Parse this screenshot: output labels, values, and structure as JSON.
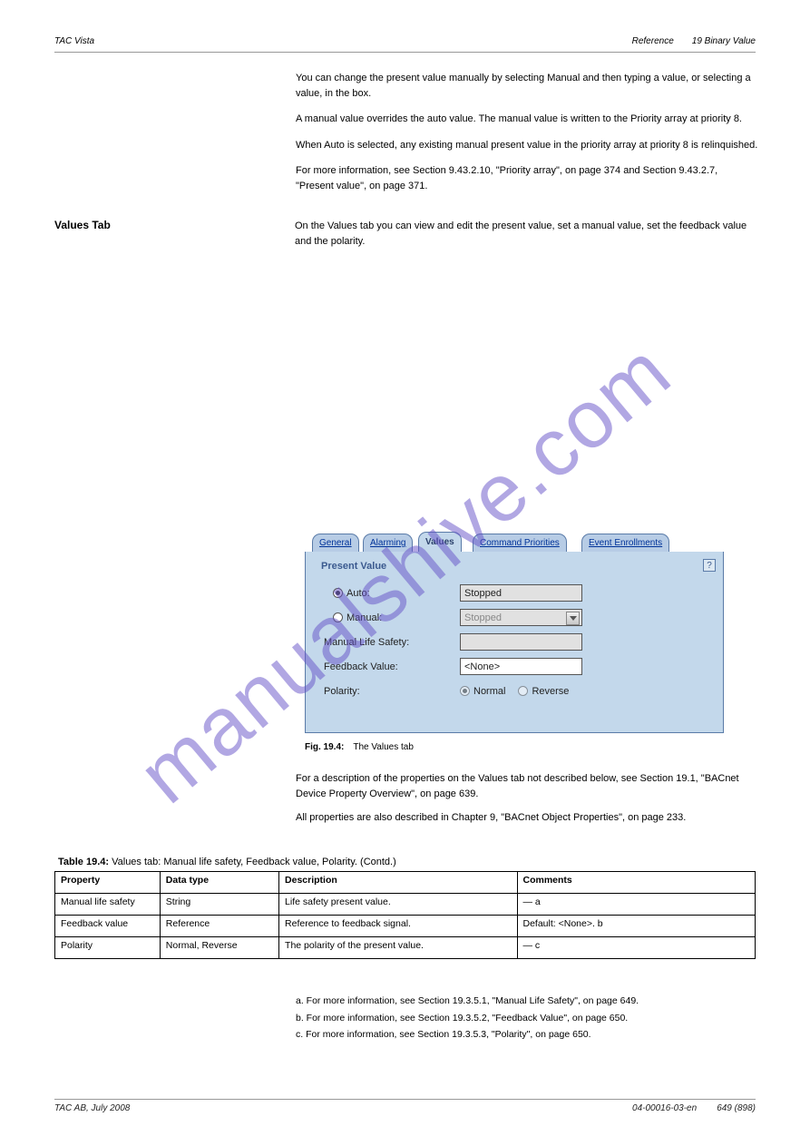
{
  "header": {
    "left": "TAC Vista",
    "center": "Reference",
    "right": "19 Binary Value"
  },
  "intro": {
    "p1": "You can change the present value manually by selecting Manual and then typing a value, or selecting a value, in the box.",
    "p2": "A manual value overrides the auto value. The manual value is written to the Priority array at priority 8.",
    "p3": "When Auto is selected, any existing manual present value in the priority array at priority 8 is relinquished.",
    "p4": "For more information, see Section 9.43.2.10, \"Priority array\", on page 374 and Section 9.43.2.7, \"Present value\", on page 371."
  },
  "section": {
    "label": "Values Tab",
    "text": "On the Values tab you can view and edit the present value, set a manual value, set the feedback value and the polarity."
  },
  "ui": {
    "tabs": [
      "General",
      "Alarming",
      "Values",
      "Command Priorities",
      "Event Enrollments"
    ],
    "activeTab": "Values",
    "panelTitle": "Present Value",
    "helpLabel": "?",
    "rows": {
      "auto": {
        "radioLabel": "Auto:",
        "value": "Stopped"
      },
      "manual": {
        "radioLabel": "Manual:",
        "value": "Stopped"
      },
      "mls": {
        "label": "Manual Life Safety:",
        "value": ""
      },
      "feedback": {
        "label": "Feedback Value:",
        "value": "<None>"
      },
      "polarity": {
        "label": "Polarity:",
        "opt1": "Normal",
        "opt2": "Reverse"
      }
    }
  },
  "caption": {
    "label": "Fig. 19.4:",
    "text": "The Values tab"
  },
  "mid": {
    "p1": "For a description of the properties on the Values tab not described below, see Section 19.1, \"BACnet Device Property Overview\", on page 639.",
    "p2": "All properties are also described in Chapter 9, \"BACnet Object Properties\", on page 233."
  },
  "table": {
    "title": {
      "label": "Table 19.4:",
      "text": "Values tab: Manual life safety, Feedback value, Polarity. (Contd.)"
    },
    "cols": [
      "Property",
      "Data type",
      "Description",
      "Comments"
    ],
    "rows": [
      [
        "Manual life safety",
        "String",
        "Life safety present value.",
        "— a"
      ],
      [
        "Feedback value",
        "Reference",
        "Reference to feedback signal.",
        "Default: <None>. b"
      ],
      [
        "Polarity",
        "Normal, Reverse",
        "The polarity of the present value.",
        "— c"
      ]
    ]
  },
  "footnotes": {
    "a": "a. For more information, see Section 19.3.5.1, \"Manual Life Safety\", on page 649.",
    "b": "b. For more information, see Section 19.3.5.2, \"Feedback Value\", on page 650.",
    "c": "c. For more information, see Section 19.3.5.3, \"Polarity\", on page 650."
  },
  "footer": {
    "left": "TAC AB, July 2008",
    "center": "04-00016-03-en",
    "right": "649 (898)"
  }
}
